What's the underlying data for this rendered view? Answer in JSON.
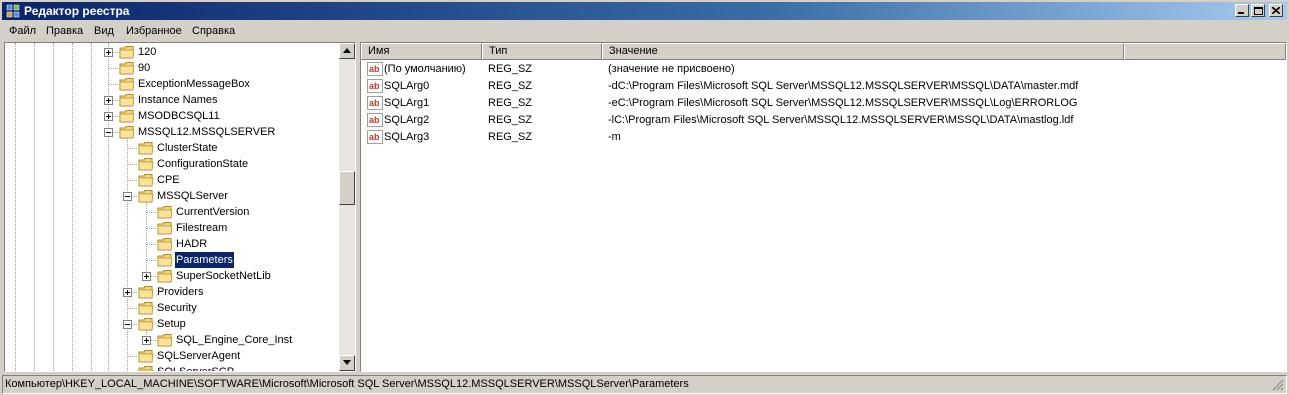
{
  "window": {
    "title": "Редактор реестра"
  },
  "menu": [
    "Файл",
    "Правка",
    "Вид",
    "Избранное",
    "Справка"
  ],
  "tree": [
    {
      "label": "120",
      "depth": 0,
      "expander": "plus",
      "selected": false
    },
    {
      "label": "90",
      "depth": 0,
      "expander": "none",
      "selected": false
    },
    {
      "label": "ExceptionMessageBox",
      "depth": 0,
      "expander": "none",
      "selected": false
    },
    {
      "label": "Instance Names",
      "depth": 0,
      "expander": "plus",
      "selected": false
    },
    {
      "label": "MSODBCSQL11",
      "depth": 0,
      "expander": "plus",
      "selected": false
    },
    {
      "label": "MSSQL12.MSSQLSERVER",
      "depth": 0,
      "expander": "minus",
      "selected": false
    },
    {
      "label": "ClusterState",
      "depth": 1,
      "expander": "none",
      "selected": false
    },
    {
      "label": "ConfigurationState",
      "depth": 1,
      "expander": "none",
      "selected": false
    },
    {
      "label": "CPE",
      "depth": 1,
      "expander": "none",
      "selected": false
    },
    {
      "label": "MSSQLServer",
      "depth": 1,
      "expander": "minus",
      "selected": false
    },
    {
      "label": "CurrentVersion",
      "depth": 2,
      "expander": "none",
      "selected": false
    },
    {
      "label": "Filestream",
      "depth": 2,
      "expander": "none",
      "selected": false
    },
    {
      "label": "HADR",
      "depth": 2,
      "expander": "none",
      "selected": false
    },
    {
      "label": "Parameters",
      "depth": 2,
      "expander": "none",
      "selected": true
    },
    {
      "label": "SuperSocketNetLib",
      "depth": 2,
      "expander": "plus",
      "selected": false
    },
    {
      "label": "Providers",
      "depth": 1,
      "expander": "plus",
      "selected": false
    },
    {
      "label": "Security",
      "depth": 1,
      "expander": "none",
      "selected": false
    },
    {
      "label": "Setup",
      "depth": 1,
      "expander": "minus",
      "selected": false
    },
    {
      "label": "SQL_Engine_Core_Inst",
      "depth": 2,
      "expander": "plus",
      "selected": false
    },
    {
      "label": "SQLServerAgent",
      "depth": 1,
      "expander": "none",
      "selected": false
    },
    {
      "label": "SQLServerSCP",
      "depth": 1,
      "expander": "none",
      "selected": false
    }
  ],
  "columns": {
    "name": "Имя",
    "type": "Тип",
    "value": "Значение"
  },
  "values": [
    {
      "name": "(По умолчанию)",
      "type": "REG_SZ",
      "data": "(значение не присвоено)",
      "icon": "string-value-icon"
    },
    {
      "name": "SQLArg0",
      "type": "REG_SZ",
      "data": "-dC:\\Program Files\\Microsoft SQL Server\\MSSQL12.MSSQLSERVER\\MSSQL\\DATA\\master.mdf",
      "icon": "string-value-icon"
    },
    {
      "name": "SQLArg1",
      "type": "REG_SZ",
      "data": "-eC:\\Program Files\\Microsoft SQL Server\\MSSQL12.MSSQLSERVER\\MSSQL\\Log\\ERRORLOG",
      "icon": "string-value-icon"
    },
    {
      "name": "SQLArg2",
      "type": "REG_SZ",
      "data": "-lC:\\Program Files\\Microsoft SQL Server\\MSSQL12.MSSQLSERVER\\MSSQL\\DATA\\mastlog.ldf",
      "icon": "string-value-icon"
    },
    {
      "name": "SQLArg3",
      "type": "REG_SZ",
      "data": "-m",
      "icon": "string-value-icon"
    }
  ],
  "status": {
    "path": "Компьютер\\HKEY_LOCAL_MACHINE\\SOFTWARE\\Microsoft\\Microsoft SQL Server\\MSSQL12.MSSQLSERVER\\MSSQLServer\\Parameters"
  },
  "colors": {
    "titlebar": "#0a246a",
    "selection": "#0a246a",
    "folder": "#f5d76e",
    "string_icon": "#c0392b"
  }
}
